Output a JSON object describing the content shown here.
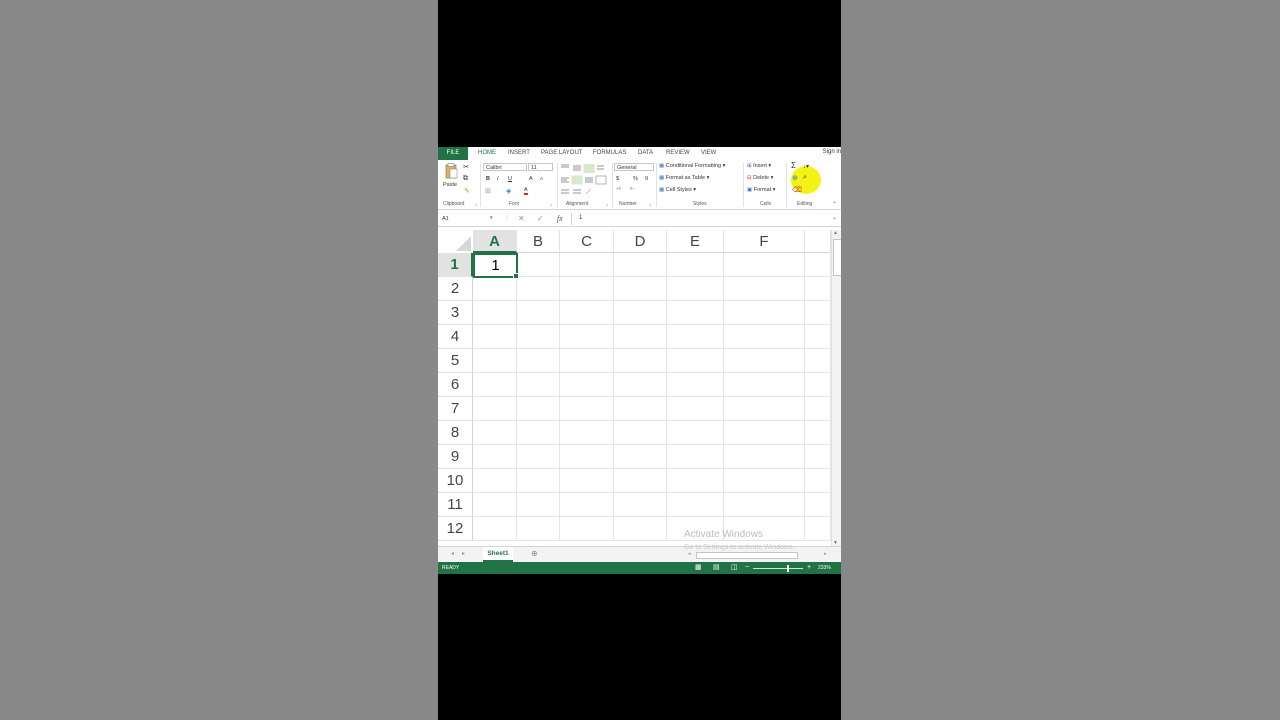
{
  "ribbon_tabs": {
    "file": "FILE",
    "home": "HOME",
    "insert": "INSERT",
    "page_layout": "PAGE LAYOUT",
    "formulas": "FORMULAS",
    "data": "DATA",
    "review": "REVIEW",
    "view": "VIEW",
    "signin": "Sign in"
  },
  "clipboard": {
    "paste": "Paste",
    "label": "Clipboard"
  },
  "font": {
    "name": "Calibri",
    "size": "11",
    "bold": "B",
    "italic": "I",
    "underline": "U",
    "grow": "A",
    "shrink": "A",
    "color": "A",
    "label": "Font"
  },
  "alignment": {
    "label": "Alignment"
  },
  "number": {
    "format": "General",
    "currency": "$",
    "percent": "%",
    "comma": "9",
    "label": "Number"
  },
  "styles": {
    "conditional": "Conditional Formatting",
    "table": "Format as Table",
    "cell_styles": "Cell Styles",
    "label": "Styles"
  },
  "cells": {
    "insert": "Insert",
    "delete": "Delete",
    "format": "Format",
    "label": "Cells"
  },
  "editing": {
    "label": "Editing",
    "sum_symbol": "Σ"
  },
  "formula_bar": {
    "name_box": "A1",
    "fx": "fx",
    "value": "1"
  },
  "grid": {
    "columns": [
      "A",
      "B",
      "C",
      "D",
      "E",
      "F"
    ],
    "rows": [
      "1",
      "2",
      "3",
      "4",
      "5",
      "6",
      "7",
      "8",
      "9",
      "10",
      "11",
      "12"
    ],
    "a1_value": "1"
  },
  "sheet_tab": "Sheet1",
  "status": {
    "ready": "READY",
    "zoom": "233%"
  },
  "watermark": {
    "line1": "Activate Windows",
    "line2": "Go to Settings to activate Windows."
  },
  "colors": {
    "accent": "#217346",
    "highlight": "#f5f215"
  }
}
